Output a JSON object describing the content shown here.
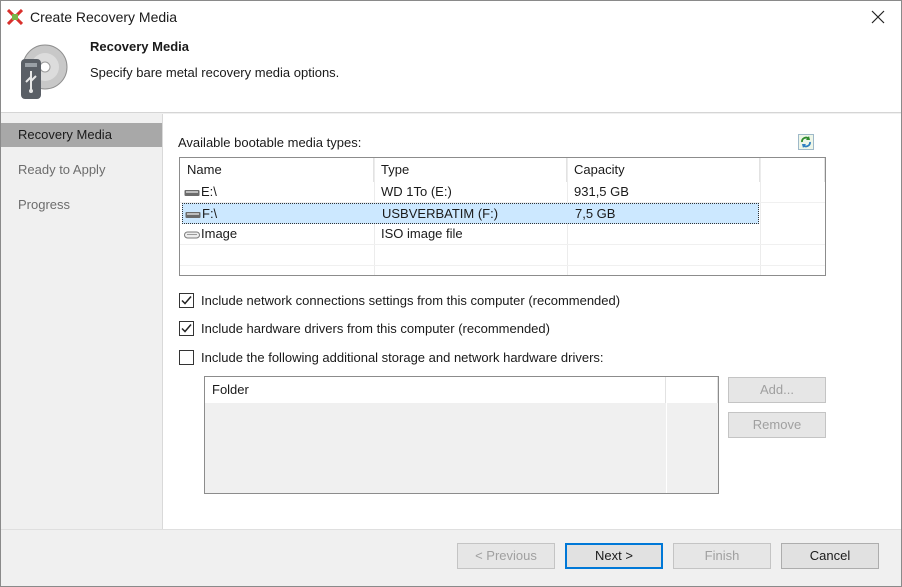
{
  "window": {
    "title": "Create Recovery Media"
  },
  "header": {
    "title": "Recovery Media",
    "description": "Specify bare metal recovery media options."
  },
  "sidebar": {
    "items": [
      {
        "label": "Recovery Media",
        "active": true
      },
      {
        "label": "Ready to Apply",
        "active": false
      },
      {
        "label": "Progress",
        "active": false
      }
    ]
  },
  "main": {
    "available_label": "Available bootable media types:",
    "media_table": {
      "columns": [
        "Name",
        "Type",
        "Capacity"
      ],
      "rows": [
        {
          "name": "E:\\",
          "type": "WD 1To (E:)",
          "capacity": "931,5 GB",
          "icon": "hard-drive-icon"
        },
        {
          "name": "F:\\",
          "type": "USBVERBATIM (F:)",
          "capacity": "7,5 GB",
          "icon": "usb-drive-icon",
          "selected": true
        },
        {
          "name": "Image",
          "type": "ISO image file",
          "capacity": "",
          "icon": "disc-image-icon"
        }
      ]
    },
    "options": [
      {
        "label": "Include network connections settings from this computer (recommended)",
        "checked": true
      },
      {
        "label": "Include hardware drivers from this computer (recommended)",
        "checked": true
      },
      {
        "label": "Include the following additional storage and network hardware drivers:",
        "checked": false
      }
    ],
    "folder_table": {
      "column": "Folder"
    },
    "add_label": "Add...",
    "remove_label": "Remove"
  },
  "footer": {
    "previous_label": "< Previous",
    "next_label": "Next >",
    "finish_label": "Finish",
    "cancel_label": "Cancel"
  },
  "colors": {
    "selection": "#cce8ff",
    "default_button_border": "#0078d7",
    "sidebar_active": "#a8a8a8"
  }
}
